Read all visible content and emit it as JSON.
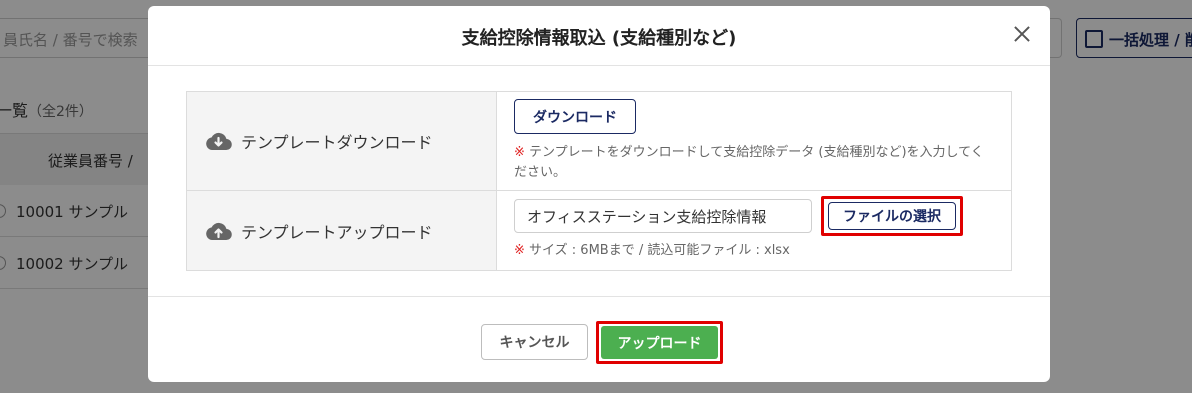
{
  "background": {
    "search_placeholder": "員氏名 / 番号で検索",
    "batch_button_label": "一括処理 / 削",
    "list_title": "一覧",
    "list_count": "（全2件）",
    "table_header_employee_no": "従業員番号 / ",
    "rows": [
      {
        "text": "10001  サンプル"
      },
      {
        "text": "10002  サンプル"
      }
    ]
  },
  "modal": {
    "title": "支給控除情報取込 (支給種別など)",
    "download_row": {
      "label": "テンプレートダウンロード",
      "button_label": "ダウンロード",
      "note_mark": "※",
      "note_text": "テンプレートをダウンロードして支給控除データ (支給種別など)を入力してください。"
    },
    "upload_row": {
      "label": "テンプレートアップロード",
      "file_name": "オフィスステーション支給控除情報",
      "select_button_label": "ファイルの選択",
      "note_mark": "※",
      "note_text": "サイズ : 6MBまで / 読込可能ファイル : xlsx"
    },
    "footer": {
      "cancel_label": "キャンセル",
      "upload_label": "アップロード"
    }
  },
  "colors": {
    "navy": "#1b2a63",
    "green": "#4caf50",
    "highlight_red": "#e00000",
    "note_red": "#e02424"
  }
}
